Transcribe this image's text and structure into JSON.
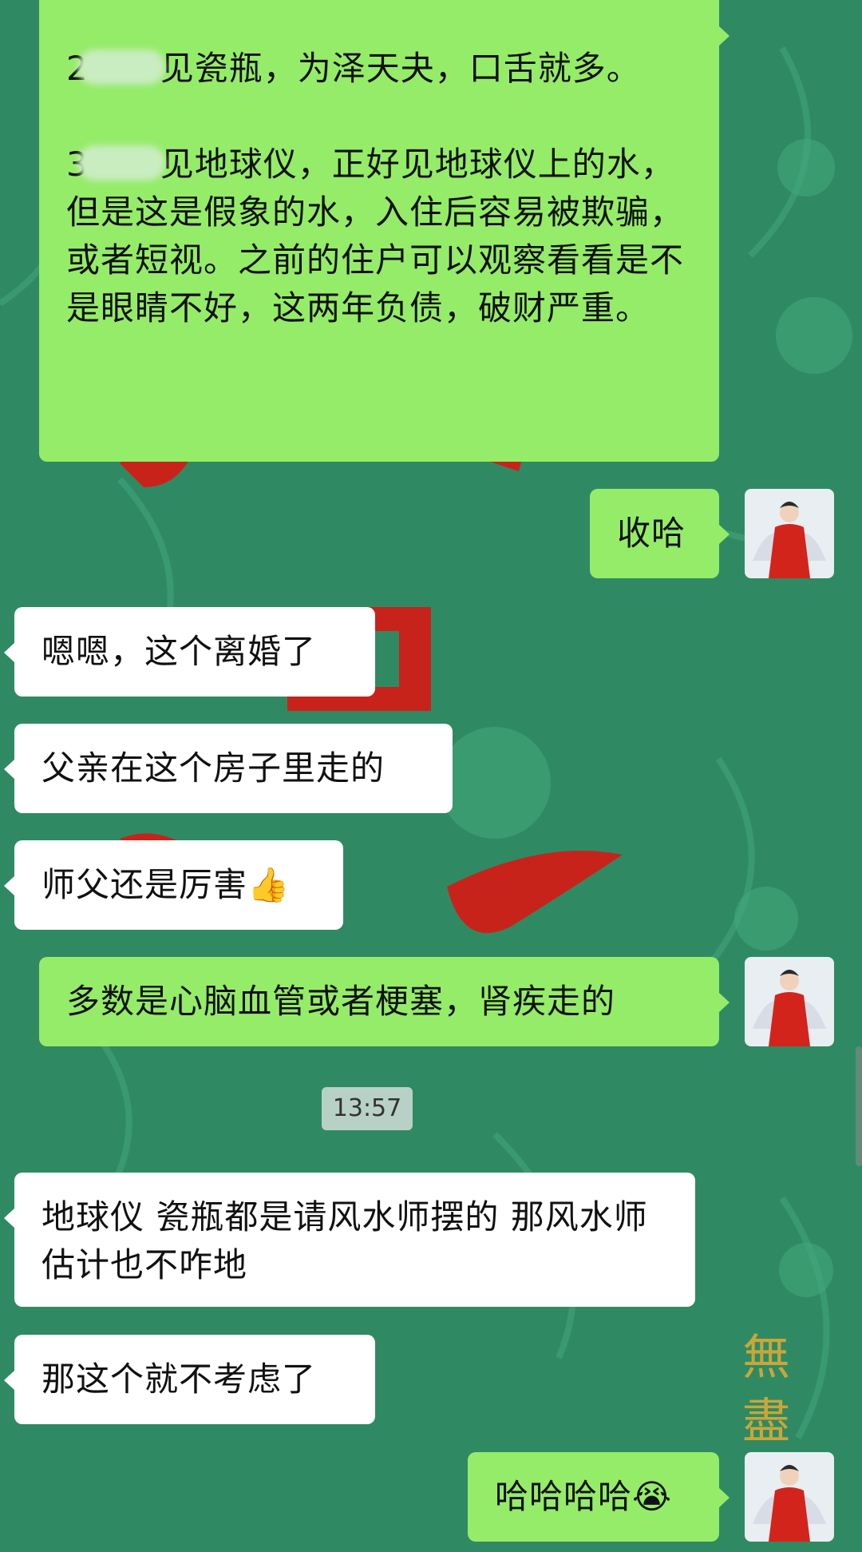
{
  "messages": [
    {
      "paragraphs": [
        [
          "2",
          "见瓷瓶，为泽天夬，口舌就多。"
        ],
        [
          "3",
          "见地球仪，正好见地球仪上的水，但是这是假象的水，入住后容易被欺骗，或者短视。之前的住户可以观察看看是不是眼睛不好，这两年负债，破财严重。"
        ]
      ]
    },
    {
      "text": "收哈"
    },
    {
      "text": "嗯嗯，这个离婚了"
    },
    {
      "text": "父亲在这个房子里走的"
    },
    {
      "text": "师父还是厉害",
      "emoji": "👍"
    },
    {
      "text": "多数是心脑血管或者梗塞，肾疾走的"
    },
    {
      "text": "地球仪 瓷瓶都是请风水师摆的 那风水师估计也不咋地"
    },
    {
      "text": "那这个就不考虑了"
    },
    {
      "text": "哈哈哈哈",
      "emoji": "😭"
    }
  ],
  "timestamp": "13:57",
  "background_text": {
    "char1": "無",
    "char2": "盡"
  },
  "colors": {
    "outgoing": "#95ec69",
    "incoming": "#ffffff",
    "background": "#2f8a63"
  },
  "icons": {
    "avatar": "avatar-red-robe-woman"
  }
}
